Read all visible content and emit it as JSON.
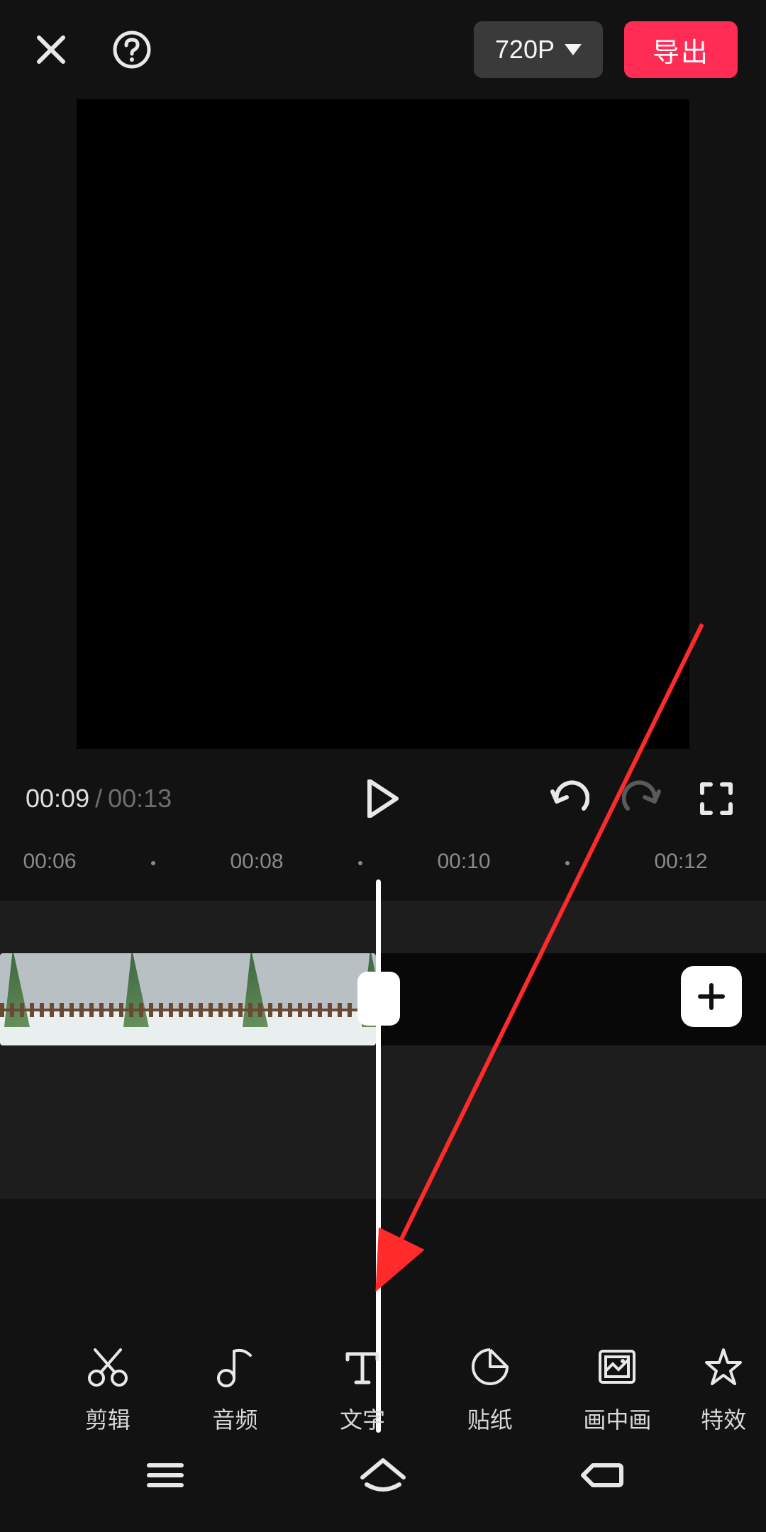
{
  "header": {
    "resolution_label": "720P",
    "export_label": "导出"
  },
  "playback": {
    "current_time": "00:09",
    "separator": "/",
    "total_time": "00:13"
  },
  "ruler": {
    "ticks": [
      "00:06",
      "00:08",
      "00:10",
      "00:12"
    ]
  },
  "tools": [
    {
      "id": "cut",
      "label": "剪辑",
      "icon": "scissors-icon"
    },
    {
      "id": "audio",
      "label": "音频",
      "icon": "music-note-icon"
    },
    {
      "id": "text",
      "label": "文字",
      "icon": "text-t-icon"
    },
    {
      "id": "sticker",
      "label": "贴纸",
      "icon": "sticker-icon"
    },
    {
      "id": "pip",
      "label": "画中画",
      "icon": "picture-in-picture-icon"
    },
    {
      "id": "effects",
      "label": "特效",
      "icon": "star-icon"
    }
  ],
  "annotation": {
    "arrow_target": "text"
  }
}
